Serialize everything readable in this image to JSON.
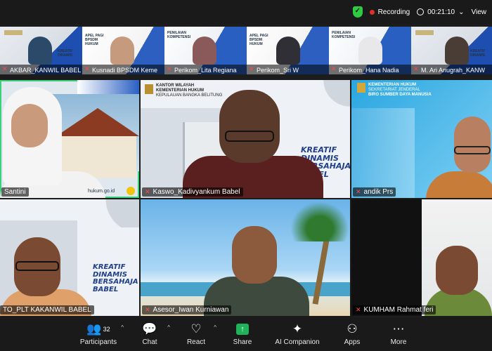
{
  "topbar": {
    "recording_label": "Recording",
    "timer": "00:21:10",
    "view_label": "View"
  },
  "thumbnails": [
    {
      "name": "AKBAR_KANWIL BABEL",
      "tag": "KREATIF DINAMIS"
    },
    {
      "name": "Kusnadi BPSDM Keme",
      "tag": "APEL PAGI BPSDM HUKUM"
    },
    {
      "name": "Perikom_Lita Regiana",
      "tag": "PENILAIAN KOMPETENSI"
    },
    {
      "name": "Perikom_Sri W",
      "tag": "APEL PAGI BPSDM HUKUM"
    },
    {
      "name": "Perikom_Hana Nadia",
      "tag": "PENILAIAN KOMPETENSI"
    },
    {
      "name": "M. Ari Anugrah_KANW",
      "tag": "KREATIF DINAMIS"
    }
  ],
  "tiles": {
    "t1": {
      "name": "Santini",
      "url": "hukum.go.id"
    },
    "t2": {
      "name": "Kaswo_Kadivyankum Babel",
      "org1": "KANTOR WILAYAH",
      "org2": "KEMENTERIAN HUKUM",
      "org3": "KEPULAUAN BANGKA BELITUNG",
      "slogan": "KREATIF DINAMIS BERSAHAJA BABEL"
    },
    "t3": {
      "name": "andik Prs",
      "org1": "KEMENTERIAN HUKUM",
      "org2": "SEKRETARIAT JENDERAL",
      "org3": "BIRO SUMBER DAYA MANUSIA"
    },
    "t4": {
      "name": "TO_PLT KAKANWIL BABEL",
      "slogan": "KREATIF DINAMIS BERSAHAJA BABEL"
    },
    "t5": {
      "name": "Asesor_Iwan Kurniawan"
    },
    "t6": {
      "name": "KUMHAM Rahmat feri"
    }
  },
  "toolbar": {
    "participants_label": "Participants",
    "participants_count": "32",
    "chat_label": "Chat",
    "react_label": "React",
    "share_label": "Share",
    "ai_label": "AI Companion",
    "apps_label": "Apps",
    "more_label": "More"
  },
  "colors": {
    "active_speaker": "#3ad17a",
    "recording": "#e0302a",
    "share": "#21b35a"
  }
}
